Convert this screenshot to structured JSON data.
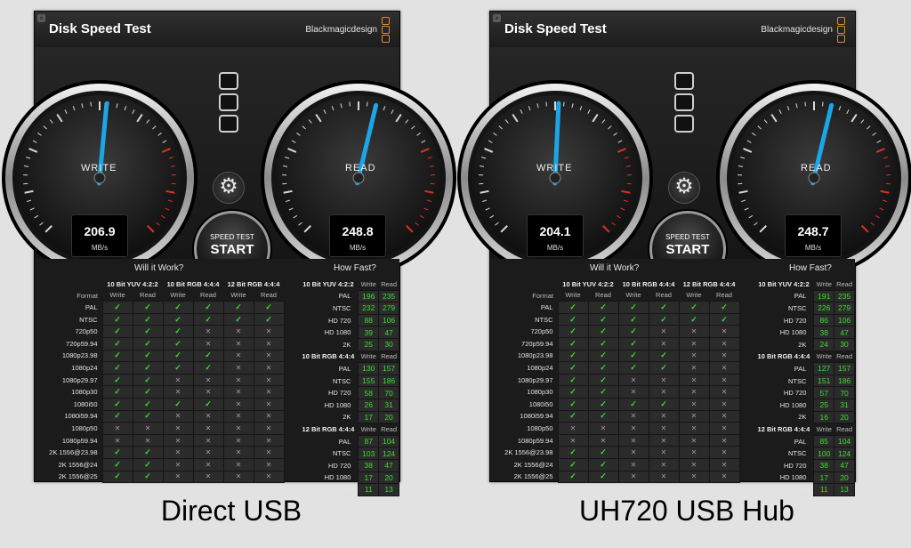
{
  "app": {
    "title": "Disk Speed Test",
    "brand": "Blackmagicdesign",
    "close_glyph": "×"
  },
  "labels": {
    "write": "WRITE",
    "read": "READ",
    "unit": "MB/s",
    "start_top": "SPEED TEST",
    "start_main": "START",
    "will_it_work": "Will it Work?",
    "how_fast": "How Fast?",
    "format": "Format",
    "write_col": "Write",
    "read_col": "Read",
    "group1": "10 Bit YUV 4:2:2",
    "group2": "10 Bit RGB 4:4:4",
    "group3": "12 Bit RGB 4:4:4"
  },
  "colors": {
    "needle": "#1aa6e8",
    "ok": "#3ddc2f",
    "redline": "#e2301c"
  },
  "icons": {
    "settings": "gear-icon",
    "close": "close-icon",
    "ok": "checkmark-icon",
    "fail": "cross-icon"
  },
  "formats": [
    "PAL",
    "NTSC",
    "720p50",
    "720p59.94",
    "1080p23.98",
    "1080p24",
    "1080p29.97",
    "1080p30",
    "1080i50",
    "1080i59.94",
    "1080p50",
    "1080p59.94",
    "2K 1556@23.98",
    "2K 1556@24",
    "2K 1556@25"
  ],
  "fast_formats": [
    "PAL",
    "NTSC",
    "HD 720",
    "HD 1080",
    "2K"
  ],
  "panels": [
    {
      "caption": "Direct USB",
      "write_value": "206.9",
      "read_value": "248.8",
      "write_level": 0.52,
      "read_level": 0.55,
      "will_it_work": [
        [
          1,
          1,
          1,
          1,
          1,
          1
        ],
        [
          1,
          1,
          1,
          1,
          1,
          1
        ],
        [
          1,
          1,
          1,
          0,
          0,
          0
        ],
        [
          1,
          1,
          1,
          0,
          0,
          0
        ],
        [
          1,
          1,
          1,
          1,
          0,
          0
        ],
        [
          1,
          1,
          1,
          1,
          0,
          0
        ],
        [
          1,
          1,
          0,
          0,
          0,
          0
        ],
        [
          1,
          1,
          0,
          0,
          0,
          0
        ],
        [
          1,
          1,
          1,
          1,
          0,
          0
        ],
        [
          1,
          1,
          0,
          0,
          0,
          0
        ],
        [
          0,
          0,
          0,
          0,
          0,
          0
        ],
        [
          0,
          0,
          0,
          0,
          0,
          0
        ],
        [
          1,
          1,
          0,
          0,
          0,
          0
        ],
        [
          1,
          1,
          0,
          0,
          0,
          0
        ],
        [
          1,
          1,
          0,
          0,
          0,
          0
        ]
      ],
      "how_fast": [
        [
          [
            196,
            235
          ],
          [
            232,
            279
          ],
          [
            88,
            106
          ],
          [
            39,
            47
          ],
          [
            25,
            30
          ]
        ],
        [
          [
            130,
            157
          ],
          [
            155,
            186
          ],
          [
            58,
            70
          ],
          [
            26,
            31
          ],
          [
            17,
            20
          ]
        ],
        [
          [
            87,
            104
          ],
          [
            103,
            124
          ],
          [
            38,
            47
          ],
          [
            17,
            20
          ],
          [
            11,
            13
          ]
        ]
      ]
    },
    {
      "caption": "UH720 USB Hub",
      "write_value": "204.1",
      "read_value": "248.7",
      "write_level": 0.51,
      "read_level": 0.55,
      "will_it_work": [
        [
          1,
          1,
          1,
          1,
          1,
          1
        ],
        [
          1,
          1,
          1,
          1,
          1,
          1
        ],
        [
          1,
          1,
          1,
          0,
          0,
          0
        ],
        [
          1,
          1,
          1,
          0,
          0,
          0
        ],
        [
          1,
          1,
          1,
          1,
          0,
          0
        ],
        [
          1,
          1,
          1,
          1,
          0,
          0
        ],
        [
          1,
          1,
          0,
          0,
          0,
          0
        ],
        [
          1,
          1,
          0,
          0,
          0,
          0
        ],
        [
          1,
          1,
          1,
          1,
          0,
          0
        ],
        [
          1,
          1,
          0,
          0,
          0,
          0
        ],
        [
          0,
          0,
          0,
          0,
          0,
          0
        ],
        [
          0,
          0,
          0,
          0,
          0,
          0
        ],
        [
          1,
          1,
          0,
          0,
          0,
          0
        ],
        [
          1,
          1,
          0,
          0,
          0,
          0
        ],
        [
          1,
          1,
          0,
          0,
          0,
          0
        ]
      ],
      "how_fast": [
        [
          [
            191,
            235
          ],
          [
            226,
            279
          ],
          [
            86,
            106
          ],
          [
            38,
            47
          ],
          [
            24,
            30
          ]
        ],
        [
          [
            127,
            157
          ],
          [
            151,
            186
          ],
          [
            57,
            70
          ],
          [
            25,
            31
          ],
          [
            16,
            20
          ]
        ],
        [
          [
            85,
            104
          ],
          [
            100,
            124
          ],
          [
            38,
            47
          ],
          [
            17,
            20
          ],
          [
            11,
            13
          ]
        ]
      ]
    }
  ]
}
